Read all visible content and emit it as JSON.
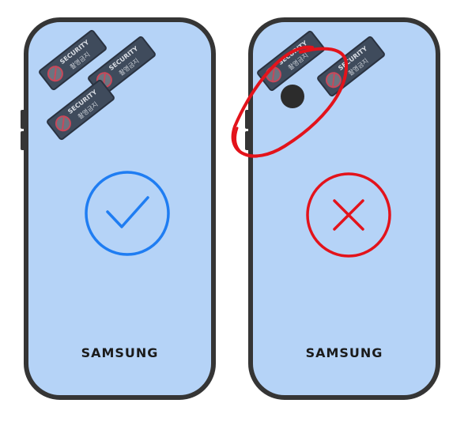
{
  "phones": [
    {
      "brand": "SAMSUNG",
      "result": "correct",
      "stickers": [
        {
          "title": "SECURITY",
          "subtitle": "촬영금지"
        },
        {
          "title": "SECURITY",
          "subtitle": "촬영금지"
        },
        {
          "title": "SECURITY",
          "subtitle": "촬영금지"
        }
      ]
    },
    {
      "brand": "SAMSUNG",
      "result": "incorrect",
      "stickers": [
        {
          "title": "SECURITY",
          "subtitle": "촬영금지"
        },
        {
          "title": "SECURITY",
          "subtitle": "촬영금지"
        }
      ]
    }
  ],
  "colors": {
    "phone_screen": "#b5d3f7",
    "phone_frame": "#353535",
    "check": "#1f7df2",
    "cross": "#e3131b",
    "highlight_ring": "#e3131b"
  },
  "icons": {
    "check": "check-circle-icon",
    "cross": "x-circle-icon",
    "sticker": "no-camera-icon"
  }
}
